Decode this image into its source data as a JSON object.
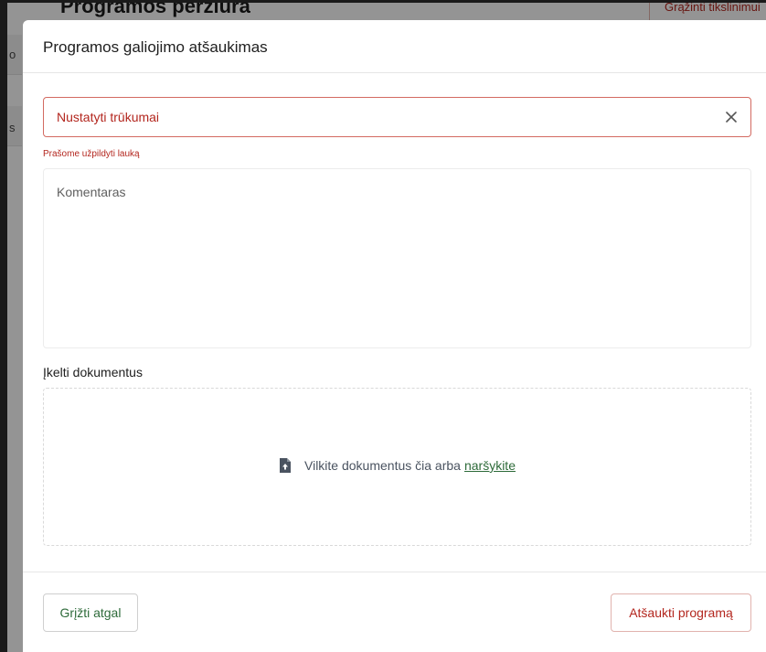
{
  "background": {
    "page_title": "Programos peržiūra",
    "return_button_label": "Grąžinti tikslinimui",
    "side_letters": [
      "o",
      "s"
    ]
  },
  "modal": {
    "title": "Programos galiojimo atšaukimas",
    "deficiencies_select": {
      "value": "Nustatyti trūkumai",
      "error": "Prašome užpildyti lauką",
      "clear_icon": "close-icon"
    },
    "comment": {
      "placeholder": "Komentaras"
    },
    "upload": {
      "label": "Įkelti dokumentus",
      "drop_text": "Vilkite dokumentus čia arba",
      "browse_link": "naršykite",
      "icon": "file-upload-icon"
    },
    "footer": {
      "back_label": "Grįžti atgal",
      "revoke_label": "Atšaukti programą"
    }
  },
  "colors": {
    "error": "#b3261e",
    "accent_green": "#2e6b3a",
    "overlay": "rgba(0,0,0,0.42)"
  }
}
